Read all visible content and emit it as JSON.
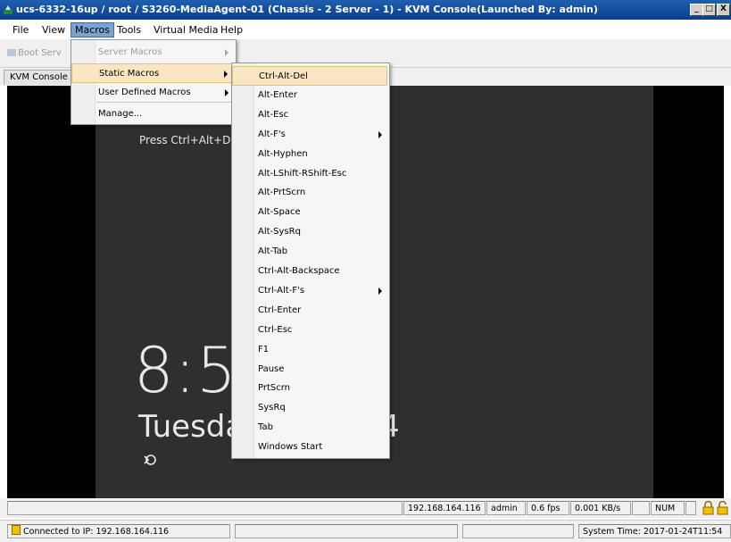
{
  "window": {
    "title": "ucs-6332-16up / root / S3260-MediaAgent-01 (Chassis - 2 Server - 1) - KVM Console(Launched By: admin)",
    "min_glyph": "_",
    "max_glyph": "□",
    "close_glyph": "X"
  },
  "menubar": {
    "items": [
      "File",
      "View",
      "Macros",
      "Tools",
      "Virtual Media",
      "Help"
    ],
    "active": "Macros"
  },
  "toolbar": {
    "boot_label": "Boot Serv"
  },
  "tabs": {
    "kvm_console": "KVM Console"
  },
  "macros_menu": {
    "items": [
      {
        "label": "Server Macros",
        "disabled": true,
        "submenu": true
      },
      {
        "label": "Static Macros",
        "selected": true,
        "submenu": true
      },
      {
        "label": "User Defined Macros",
        "submenu": true
      },
      {
        "label": "Manage..."
      }
    ]
  },
  "static_macros": {
    "items": [
      {
        "label": "Ctrl-Alt-Del",
        "selected": true
      },
      {
        "label": "Alt-Enter"
      },
      {
        "label": "Alt-Esc"
      },
      {
        "label": "Alt-F's",
        "submenu": true
      },
      {
        "label": "Alt-Hyphen"
      },
      {
        "label": "Alt-LShift-RShift-Esc"
      },
      {
        "label": "Alt-PrtScrn"
      },
      {
        "label": "Alt-Space"
      },
      {
        "label": "Alt-SysRq"
      },
      {
        "label": "Alt-Tab"
      },
      {
        "label": "Ctrl-Alt-Backspace"
      },
      {
        "label": "Ctrl-Alt-F's",
        "submenu": true
      },
      {
        "label": "Ctrl-Enter"
      },
      {
        "label": "Ctrl-Esc"
      },
      {
        "label": "F1"
      },
      {
        "label": "Pause"
      },
      {
        "label": "PrtScrn"
      },
      {
        "label": "SysRq"
      },
      {
        "label": "Tab"
      },
      {
        "label": "Windows Start"
      }
    ]
  },
  "console": {
    "press_text": "Press Ctrl+Alt+Del",
    "clock": "8:5",
    "day": "Tuesday",
    "day_tail": "4"
  },
  "status": {
    "ip": "192.168.164.116",
    "user": "admin",
    "fps": "0.6 fps",
    "rate": "0.001 KB/s",
    "num": "NUM",
    "connected": "Connected to IP: 192.168.164.116",
    "system_time": "System Time: 2017-01-24T11:54"
  },
  "colors": {
    "titlebar": "#0a3f8a",
    "menu_active": "#7da2ce",
    "menu_selected": "#fbe6c4",
    "console_bg": "#2f2f2f"
  }
}
